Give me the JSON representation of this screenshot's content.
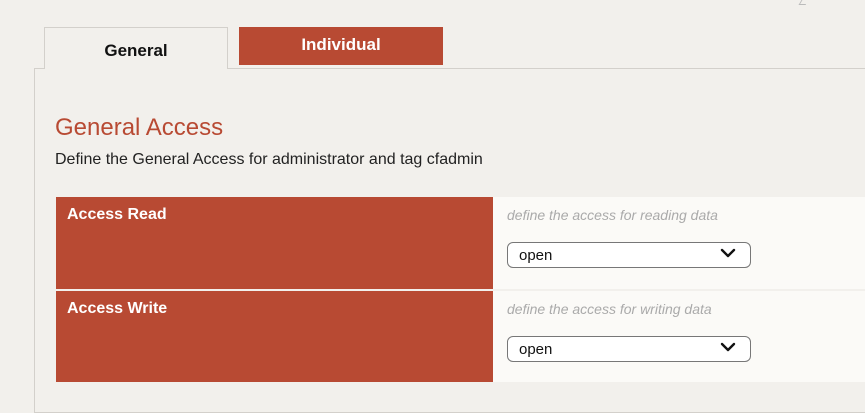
{
  "tabs": [
    {
      "label": "General",
      "active": true
    },
    {
      "label": "Individual",
      "active": false
    }
  ],
  "section": {
    "title": "General Access",
    "description": "Define the General Access for administrator and tag cfadmin"
  },
  "rows": [
    {
      "label": "Access Read",
      "hint": "define the access for reading data",
      "value": "open"
    },
    {
      "label": "Access Write",
      "hint": "define the access for writing data",
      "value": "open"
    }
  ],
  "colors": {
    "accent": "#b84a33",
    "background": "#f2f0ec"
  },
  "icons": {
    "select_chevron": "chevron-down-icon"
  }
}
